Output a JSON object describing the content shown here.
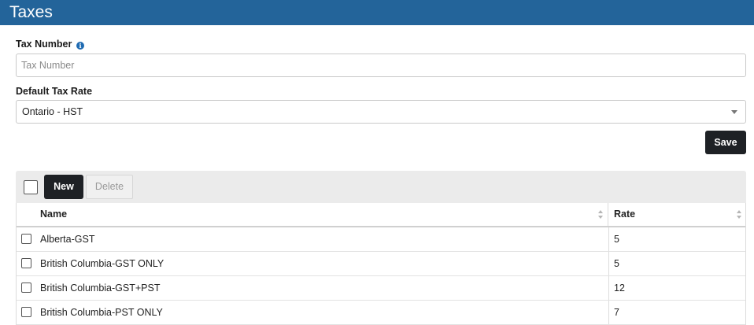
{
  "header": {
    "title": "Taxes"
  },
  "tax_number": {
    "label": "Tax Number",
    "placeholder": "Tax Number",
    "value": ""
  },
  "default_tax_rate": {
    "label": "Default Tax Rate",
    "selected": "Ontario - HST"
  },
  "save_label": "Save",
  "toolbar": {
    "new_label": "New",
    "delete_label": "Delete"
  },
  "table": {
    "columns": [
      "Name",
      "Rate"
    ],
    "rows": [
      {
        "name": "Alberta-GST",
        "rate": "5"
      },
      {
        "name": "British Columbia-GST ONLY",
        "rate": "5"
      },
      {
        "name": "British Columbia-GST+PST",
        "rate": "12"
      },
      {
        "name": "British Columbia-PST ONLY",
        "rate": "7"
      }
    ]
  },
  "icons": {
    "info": "info-icon",
    "caret": "chevron-down-icon",
    "sort": "sort-icon"
  },
  "colors": {
    "header": "#23649a",
    "primary_button": "#1e2125",
    "info_icon": "#1f6bb2"
  }
}
